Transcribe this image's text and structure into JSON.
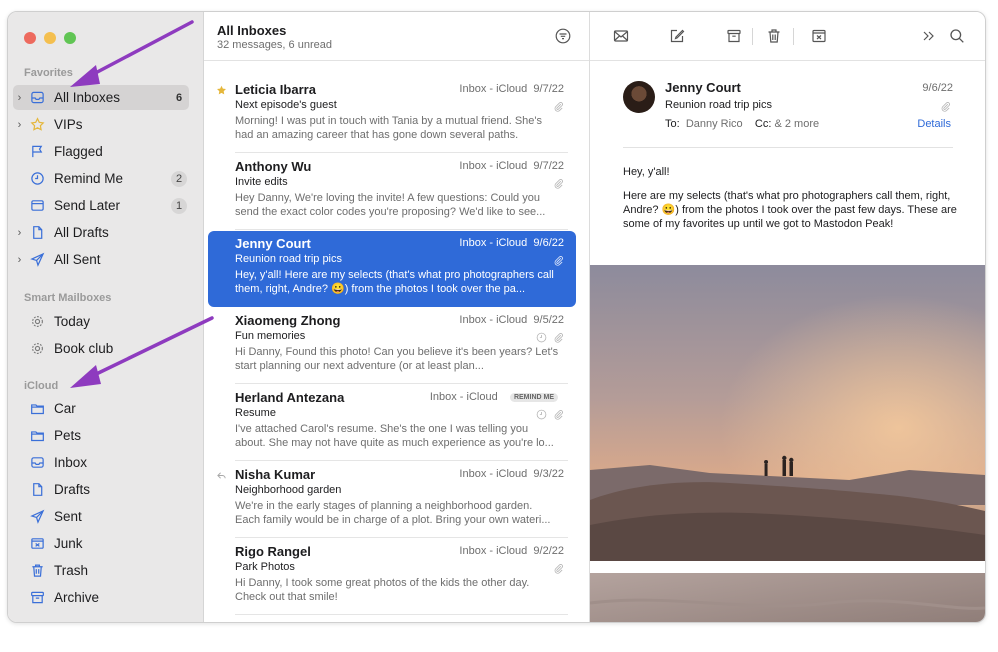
{
  "sidebar": {
    "sections": {
      "favorites": "Favorites",
      "smart": "Smart Mailboxes",
      "icloud": "iCloud"
    },
    "favorites": [
      {
        "label": "All Inboxes",
        "badge": "6",
        "icon": "inbox-tray-icon"
      },
      {
        "label": "VIPs",
        "badge": "",
        "icon": "star-icon"
      },
      {
        "label": "Flagged",
        "badge": "",
        "icon": "flag-icon"
      },
      {
        "label": "Remind Me",
        "badge": "2",
        "icon": "clock-icon"
      },
      {
        "label": "Send Later",
        "badge": "1",
        "icon": "send-later-icon"
      },
      {
        "label": "All Drafts",
        "badge": "",
        "icon": "document-icon"
      },
      {
        "label": "All Sent",
        "badge": "",
        "icon": "paper-plane-icon"
      }
    ],
    "smart": [
      {
        "label": "Today",
        "icon": "gear-folder-icon"
      },
      {
        "label": "Book club",
        "icon": "gear-folder-icon"
      }
    ],
    "icloud": [
      {
        "label": "Car",
        "icon": "folder-icon"
      },
      {
        "label": "Pets",
        "icon": "folder-icon"
      },
      {
        "label": "Inbox",
        "icon": "inbox-tray-icon"
      },
      {
        "label": "Drafts",
        "icon": "document-icon"
      },
      {
        "label": "Sent",
        "icon": "paper-plane-icon"
      },
      {
        "label": "Junk",
        "icon": "junk-icon"
      },
      {
        "label": "Trash",
        "icon": "trash-icon"
      },
      {
        "label": "Archive",
        "icon": "archive-icon"
      }
    ]
  },
  "list": {
    "title": "All Inboxes",
    "subtitle": "32 messages, 6 unread",
    "messages": [
      {
        "from": "Leticia Ibarra",
        "mailbox": "Inbox - iCloud",
        "date": "9/7/22",
        "subject": "Next episode's guest",
        "preview": "Morning! I was put in touch with Tania by a mutual friend. She's had an amazing career that has gone down several paths."
      },
      {
        "from": "Anthony Wu",
        "mailbox": "Inbox - iCloud",
        "date": "9/7/22",
        "subject": "Invite edits",
        "preview": "Hey Danny, We're loving the invite! A few questions: Could you send the exact color codes you're proposing? We'd like to see..."
      },
      {
        "from": "Jenny Court",
        "mailbox": "Inbox - iCloud",
        "date": "9/6/22",
        "subject": "Reunion road trip pics",
        "preview": "Hey, y'all! Here are my selects (that's what pro photographers call them, right, Andre? 😀) from the photos I took over the pa..."
      },
      {
        "from": "Xiaomeng Zhong",
        "mailbox": "Inbox - iCloud",
        "date": "9/5/22",
        "subject": "Fun memories",
        "preview": "Hi Danny, Found this photo! Can you believe it's been years? Let's start planning our next adventure (or at least plan..."
      },
      {
        "from": "Herland Antezana",
        "mailbox": "Inbox - iCloud",
        "date": "",
        "tag": "REMIND ME",
        "subject": "Resume",
        "preview": "I've attached Carol's resume. She's the one I was telling you about. She may not have quite as much experience as you're lo..."
      },
      {
        "from": "Nisha Kumar",
        "mailbox": "Inbox - iCloud",
        "date": "9/3/22",
        "subject": "Neighborhood garden",
        "preview": "We're in the early stages of planning a neighborhood garden. Each family would be in charge of a plot. Bring your own wateri..."
      },
      {
        "from": "Rigo Rangel",
        "mailbox": "Inbox - iCloud",
        "date": "9/2/22",
        "subject": "Park Photos",
        "preview": "Hi Danny, I took some great photos of the kids the other day. Check out that smile!"
      }
    ]
  },
  "reader": {
    "from": "Jenny Court",
    "date": "9/6/22",
    "subject": "Reunion road trip pics",
    "to_label": "To:",
    "to": "Danny Rico",
    "cc_label": "Cc:",
    "cc": "& 2 more",
    "details": "Details",
    "greeting": "Hey, y'all!",
    "body_before": "Here are my selects (that's what pro photographers call them, right, Andre? ",
    "emoji": "😀",
    "body_after": ") from the photos I took over the past few days. These are some of my favorites up until we got to Mastodon Peak!"
  },
  "colors": {
    "accent": "#2f6ad8",
    "arrow": "#8e3bbf"
  }
}
